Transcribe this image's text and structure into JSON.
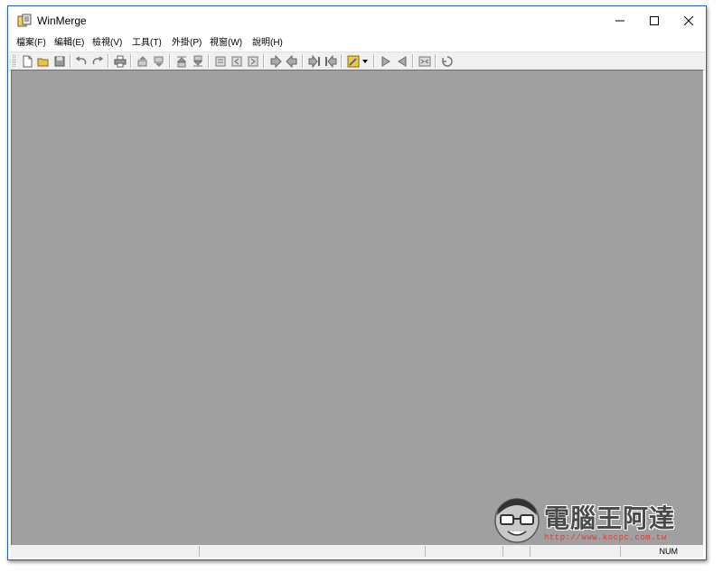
{
  "window": {
    "title": "WinMerge"
  },
  "menu": [
    {
      "label": "檔案(F)"
    },
    {
      "label": "編輯(E)"
    },
    {
      "label": "檢視(V)"
    },
    {
      "label": "工具(T)"
    },
    {
      "label": "外掛(P)"
    },
    {
      "label": "視窗(W)"
    },
    {
      "label": "說明(H)"
    }
  ],
  "toolbar": {
    "buttons": [
      "new-icon",
      "open-icon",
      "save-icon",
      "undo-icon",
      "redo-icon",
      "print-icon",
      "prev-diff-icon",
      "next-diff-icon",
      "first-diff-icon",
      "last-diff-icon",
      "current-diff-icon",
      "copy-left-icon",
      "copy-right-icon",
      "copy-to-right-icon",
      "copy-to-left-icon",
      "copy-all-right-icon",
      "copy-all-left-icon",
      "options-icon",
      "refresh-icon",
      "prev-file-icon",
      "next-file-icon",
      "expand-icon",
      "exit-icon"
    ]
  },
  "statusbar": {
    "num": "NUM"
  },
  "watermark": {
    "name": "電腦王阿達",
    "url": "http://www.kocpc.com.tw"
  },
  "colors": {
    "workspace": "#a0a0a0",
    "frame_border": "#2b5fb3",
    "toolbar": "#f0f0f0"
  }
}
